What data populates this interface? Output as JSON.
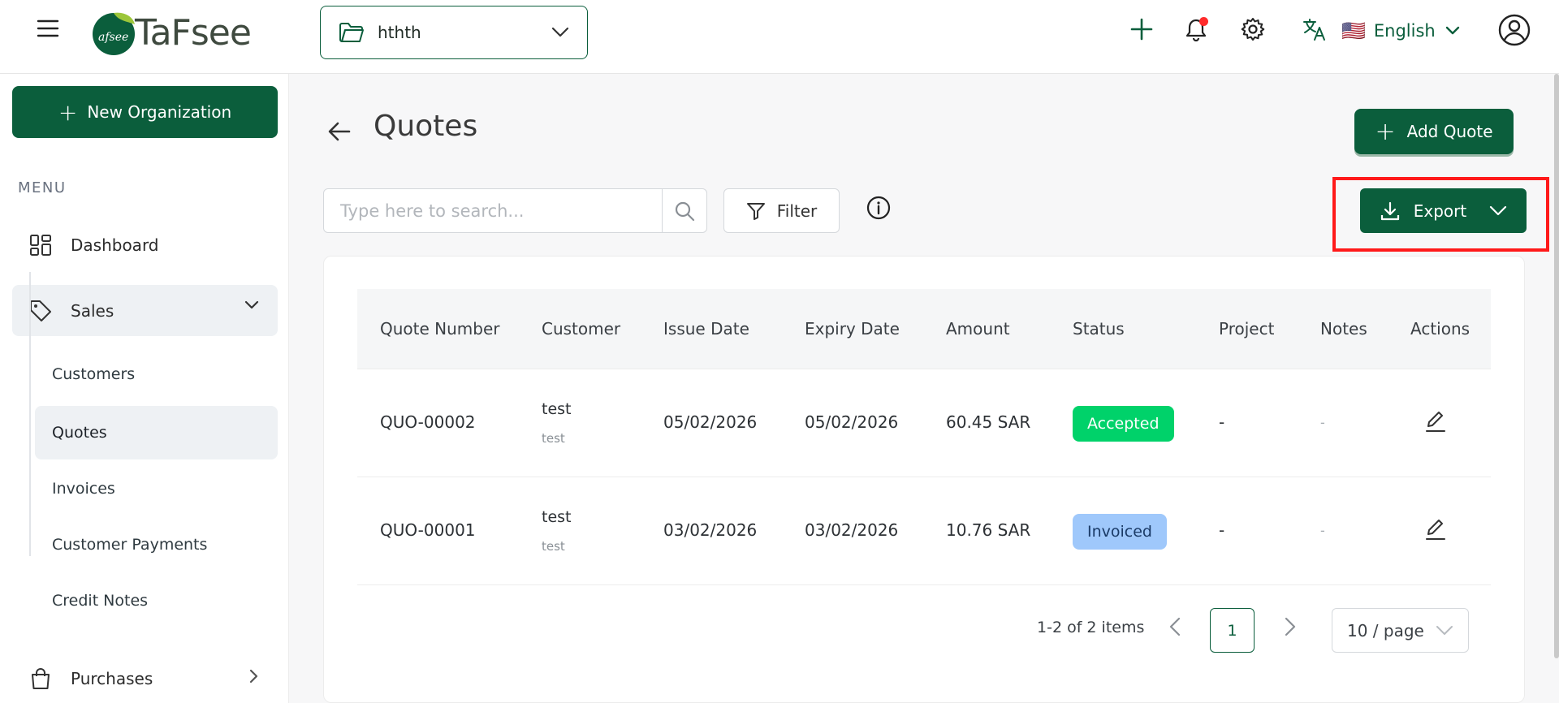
{
  "topbar": {
    "logo_text": "TaFsee",
    "logo_mark_text": "afsee",
    "org_name": "hthth",
    "language": "English",
    "flag": "🇺🇸"
  },
  "sidebar": {
    "new_org_label": "New Organization",
    "menu_label": "MENU",
    "dashboard": "Dashboard",
    "sales": "Sales",
    "sub_items": [
      "Customers",
      "Quotes",
      "Invoices",
      "Customer Payments",
      "Credit Notes"
    ],
    "purchases": "Purchases"
  },
  "page": {
    "title": "Quotes",
    "add_label": "Add Quote",
    "search_placeholder": "Type here to search...",
    "filter_label": "Filter",
    "export_label": "Export"
  },
  "table": {
    "headers": [
      "Quote Number",
      "Customer",
      "Issue Date",
      "Expiry Date",
      "Amount",
      "Status",
      "Project",
      "Notes",
      "Actions"
    ],
    "rows": [
      {
        "number": "QUO-00002",
        "customer": "test",
        "customer_sub": "test",
        "issue": "05/02/2026",
        "expiry": "05/02/2026",
        "amount": "60.45 SAR",
        "status": "Accepted",
        "project": "-",
        "notes": "-"
      },
      {
        "number": "QUO-00001",
        "customer": "test",
        "customer_sub": "test",
        "issue": "03/02/2026",
        "expiry": "03/02/2026",
        "amount": "10.76 SAR",
        "status": "Invoiced",
        "project": "-",
        "notes": "-"
      }
    ]
  },
  "pagination": {
    "summary": "1-2 of 2 items",
    "current_page": "1",
    "page_size": "10 / page"
  },
  "colors": {
    "brand": "#0b5e3c",
    "accepted": "#00d26a",
    "invoiced": "#9fc8fb",
    "highlight": "#ff1a1a"
  }
}
